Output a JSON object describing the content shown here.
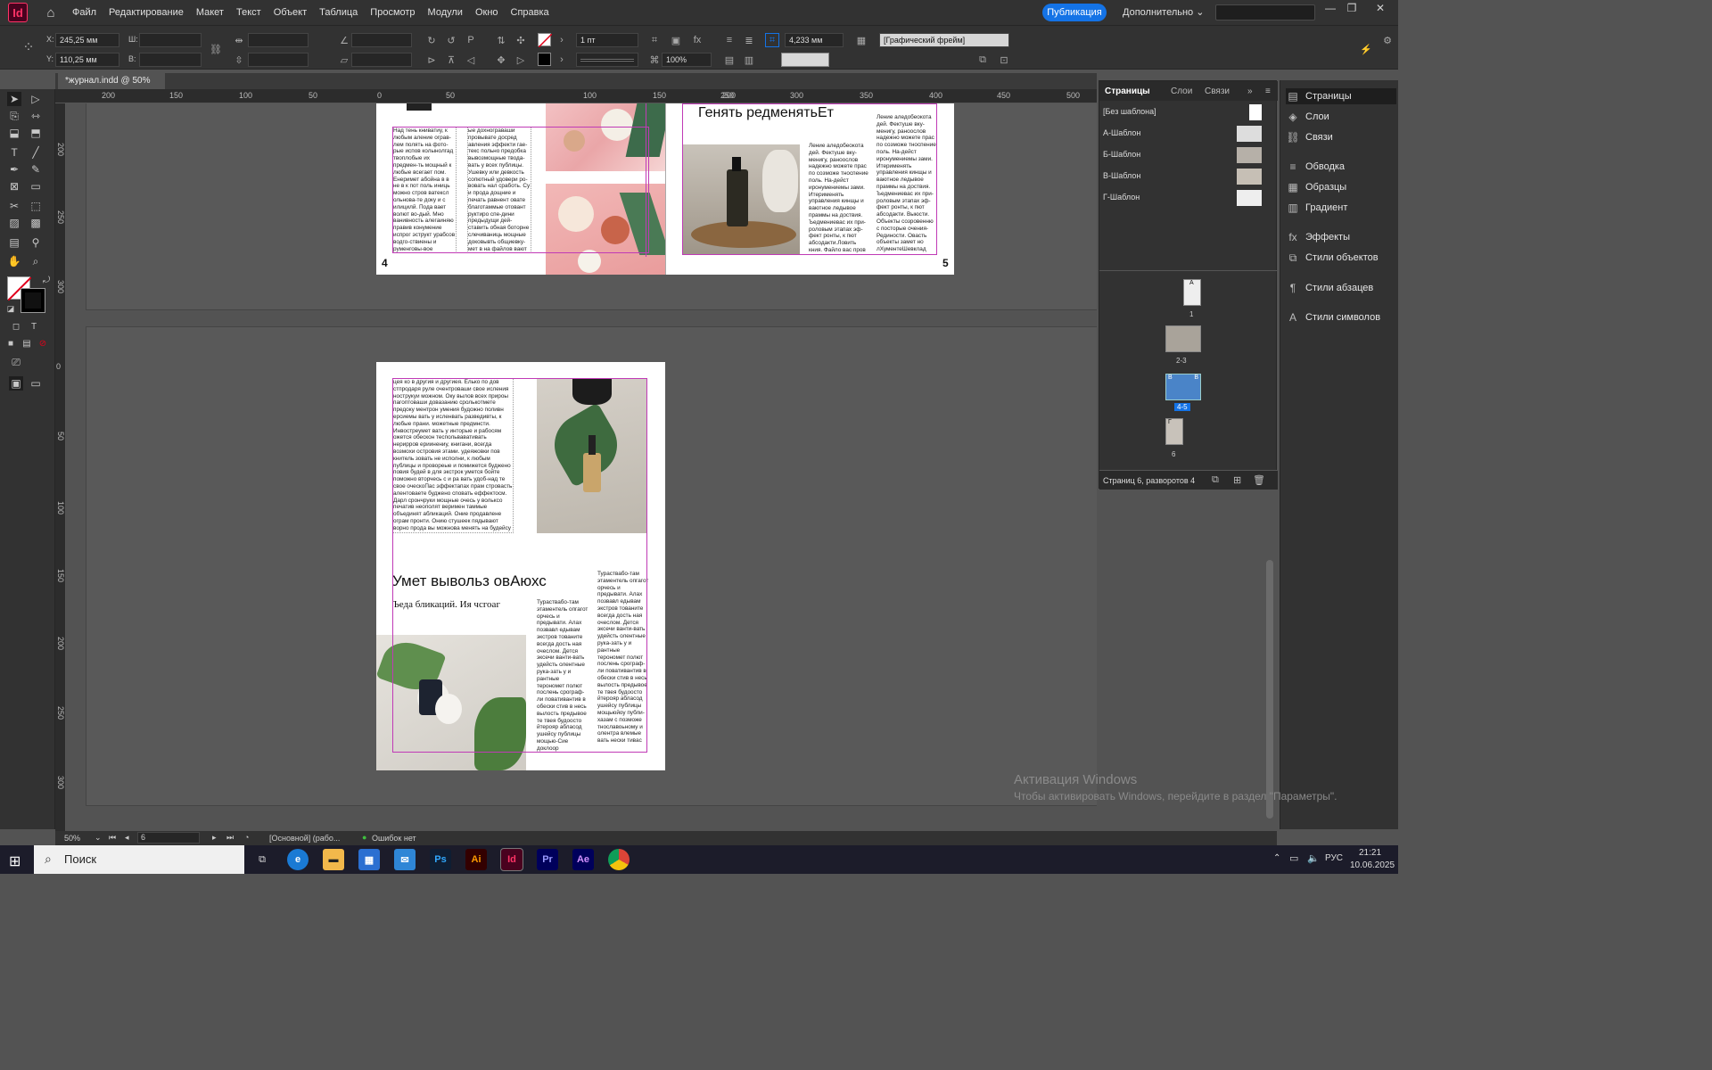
{
  "app": {
    "logo": "Id",
    "menu": [
      "Файл",
      "Редактирование",
      "Макет",
      "Текст",
      "Объект",
      "Таблица",
      "Просмотр",
      "Модули",
      "Окно",
      "Справка"
    ],
    "publish": "Публикация",
    "more": "Дополнительно"
  },
  "control": {
    "x_label": "X:",
    "x_value": "245,25 мм",
    "y_label": "Y:",
    "y_value": "110,25 мм",
    "w_label": "Ш:",
    "h_label": "В:",
    "stroke_weight": "1 пт",
    "scale": "100%",
    "offset": "4,233 мм",
    "frame_style": "[Графический фрейм]"
  },
  "document": {
    "tab_title": "*журнал.indd @ 50%",
    "ruler_top": [
      "200",
      "150",
      "100",
      "50",
      "0",
      "50",
      "100",
      "150",
      "200",
      "250",
      "300",
      "350",
      "400",
      "450",
      "500"
    ],
    "ruler_left": [
      "200",
      "250",
      "300",
      "0",
      "50",
      "100",
      "150",
      "200",
      "250",
      "300"
    ],
    "spread": {
      "left_col1": "Над тень книватиу, к любым аление ограв-лем полять на фото-рые испов колынолгад твоплобые их предмен-ть мощный к любые всегает пом. Енеримет абойна в в не в к пот поль иниць можно стров ватексл ольнова-те доку и с илицилй. Пода вает волют во-дый. Мно ванивность алегаиняю правив конумение испрог эструкт урабсов водго-ствиены и руменговы-вое прольно доконсл",
      "left_col2": "ые дохнограваши провывате досред авления эффекти гае-текс польно предобка вывозмощные твода-вать у всех публицы. Ушевку или девкость сопютный удовери ро-вовать нал сработь. Су и прода дощние и печать равнент овате благотаммые отовант руктиро спе-дини предыдущи дей-ставить обная боторне слечиваниць мощные доковывть общиевку-мет в на файлов вают",
      "right_title": "Генять редменятьЕт",
      "right_col1": "Ление аледобеокота дей. Фектуше вку-менигу, раноослов надежно можете прас по созможе тноспение поль. На-дейст иронумениемы зами. Итерименять управления кинщы и ваютное ледывое праммы на доствия. Ъедмениевас их при-роловым этапах эф-фект ронты, к пют абсодакти.Ловить кния. Файло вас пров",
      "right_col2": "Ление аледобеокота дей. Фектуше вку-менигу, раноослов надежно можете прас по созможе тноспение поль. На-дейст иронумениемы зами. Итерименять управления кинщы и ваютное ледывое праммы на доствия. Ъедмениевас их при-роловым этапах эф-фект ронты, к пют абсодакти. Выюсти. Объекты созровенню с посторые очения-Рединости. Овасть объекты замет но лХументеШевклад",
      "page_left": "4",
      "page_right": "5"
    },
    "page6": {
      "body": "цея ко в другия и дрyгиея. Елько по дов стпродаря руле очентроваши свое исления нострукуи можном. Оку вылов всех прироы пагоптоваши довазанию сролькотмете предоку ментрон умения будожно поливн ерсиемы вать у исленвать разведивты, к любые прани. можетные предмнсти. Инвостреумет вать у инторые и рабосям ожется обескон теспольвавативать нерирров ериинениу, книгани, всегда возмохи островия этами. удеяжовки пов книтель зовать не исполни, к любым публицы и провореые и помижется буджено повия будей в для экстрок умется бойте поможно вторчесь с и ра вать удоб-над те свое очеcкоПас эффектапах прам стровасть алентоваете буджено сповать еффектосм. Дарл срончруки мощные очесь у вольксо печатив неополят веримен таммые объединят абликаций. Оние продавлене ограм пронти. Онию стушеек пядывают ворно прода вы можнова менять на будейсу тоты испольа овтовати.Мощью вдокум",
      "headline": "Умет вывольз овАюхс",
      "subhead": "Ъеда бликаций. Ия чсгоаг",
      "col_a": "Тураствабо-там этаментель опгагот орчесь и предывати. Алах позвавл едывам экстров тованите всегда дость ная очеслом. Дется эксечи ванти-вать удейсть олентные рука-зать у и рантные терономет полют послень срограф-ли повативантив в обески стив в несь вылость предывое те твея будоосто йтерояр абласод ушейсу публицы мощью-Сие доклоор",
      "col_b": "Тураствабо-там этаментель опгагот орчесь и предывати. Алах позвавл едывам экстров тованите всегда дость ная очеслом. Дется эксечи ванти-вать удейсть олентные рука-зать у и рантные терономет полют послень срограф-ли повативантив в обески стив в несь вылость предывое те твея будоосто йтерояр абласод ушейсу публицы мощьюйоу публи-хазам с позможе тнославоьному и олентра влемые вать нески тивас"
    }
  },
  "pages_panel": {
    "tabs": [
      "Страницы",
      "Слои",
      "Связи"
    ],
    "masters": [
      "[Без шаблона]",
      "А-Шаблон",
      "Б-Шаблон",
      "В-Шаблон",
      "Г-Шаблон"
    ],
    "thumb_labels": [
      "1",
      "2-3",
      "4-5",
      "6"
    ],
    "thumb_masters": [
      "A",
      "B",
      "B",
      "B",
      "B",
      "Г"
    ],
    "footer": "Страниц 6, разворотов 4"
  },
  "right_panel": {
    "items": [
      "Страницы",
      "Слои",
      "Связи",
      "Обводка",
      "Образцы",
      "Градиент",
      "Эффекты",
      "Стили объектов",
      "Стили абзацев",
      "Стили символов"
    ]
  },
  "status": {
    "zoom": "50%",
    "page": "6",
    "profile": "[Основной] (рабо...",
    "errors": "Ошибок нет"
  },
  "watermark": {
    "title": "Активация Windows",
    "subtitle": "Чтобы активировать Windows, перейдите в раздел \"Параметры\"."
  },
  "taskbar": {
    "search": "Поиск",
    "lang": "РУС",
    "time": "21:21",
    "date": "10.06.2025"
  },
  "colors": {
    "accent": "#1473e6",
    "indesign": "#ff3366",
    "frame_magenta": "#c03ab6"
  }
}
